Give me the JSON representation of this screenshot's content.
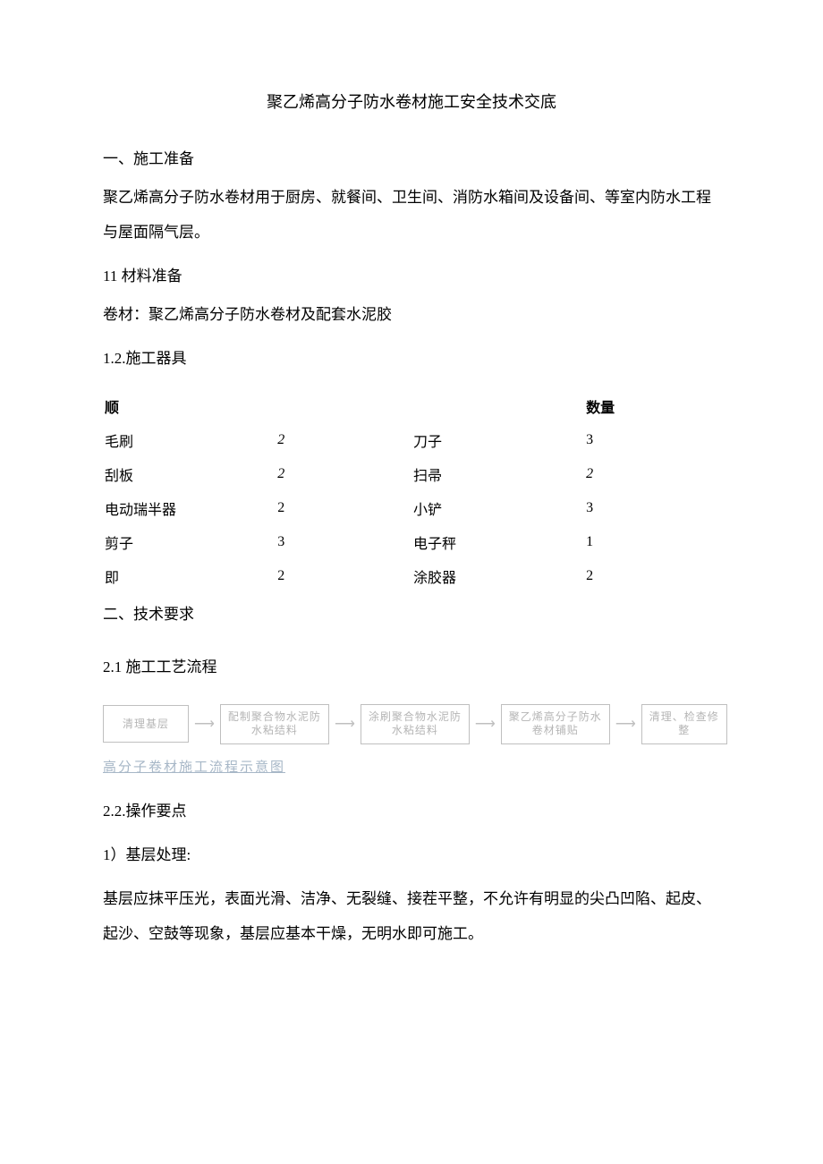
{
  "title": "聚乙烯高分子防水卷材施工安全技术交底",
  "s1_head": "一、施工准备",
  "intro": "聚乙烯高分子防水卷材用于厨房、就餐间、卫生间、消防水箱间及设备间、等室内防水工程与屋面隔气层。",
  "s1_1": "11 材料准备",
  "material": "卷材：聚乙烯高分子防水卷材及配套水泥胶",
  "s1_2": "1.2.施工器具",
  "table_head_left": "顺",
  "table_head_right": "数量",
  "tools": [
    {
      "n1": "毛刷",
      "q1": "2",
      "n2": "刀子",
      "q2": "3",
      "italic1": true,
      "italic2": false
    },
    {
      "n1": "刮板",
      "q1": "2",
      "n2": "扫帚",
      "q2": "2",
      "italic1": true,
      "italic2": true
    },
    {
      "n1": "电动瑞半器",
      "q1": "2",
      "n2": "小铲",
      "q2": "3",
      "italic1": false,
      "italic2": false
    },
    {
      "n1": "剪子",
      "q1": "3",
      "n2": "电子秤",
      "q2": "1",
      "italic1": false,
      "italic2": false
    },
    {
      "n1": "即",
      "q1": "2",
      "n2": "涂胶器",
      "q2": "2",
      "italic1": false,
      "italic2": false
    }
  ],
  "s2_head": "二、技术要求",
  "s2_1": "2.1 施工工艺流程",
  "flow": [
    "清理基层",
    "配制聚合物水泥防水粘结料",
    "涂刷聚合物水泥防水粘结料",
    "聚乙烯高分子防水卷材铺贴",
    "清理、检查修整"
  ],
  "caption": "高分子卷材施工流程示意图",
  "s2_2": "2.2.操作要点",
  "s2_2_1": "1）基层处理:",
  "s2_2_1_body": "基层应抹平压光，表面光滑、洁净、无裂缝、接茬平整，不允许有明显的尖凸凹陷、起皮、起沙、空鼓等现象，基层应基本干燥，无明水即可施工。"
}
